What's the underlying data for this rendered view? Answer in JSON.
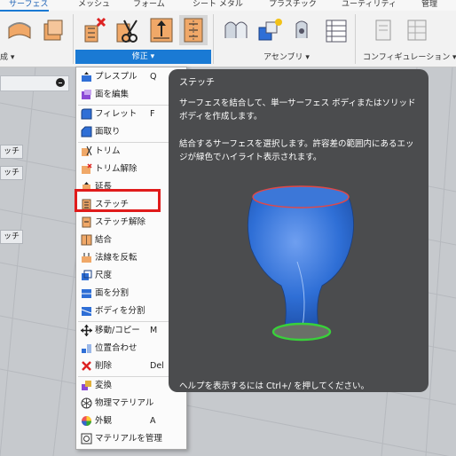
{
  "ribbon": {
    "tabs": [
      {
        "label": "サーフェス",
        "active": true
      },
      {
        "label": "メッシュ"
      },
      {
        "label": "フォーム"
      },
      {
        "label": "シート メタル"
      },
      {
        "label": "プラスチック"
      },
      {
        "label": "ユーティリティ"
      },
      {
        "label": "管理"
      }
    ],
    "groups": {
      "left_partial": "成 ▾",
      "modify": "修正 ▾",
      "assemble": "アセンブリ ▾",
      "configure": "コンフィギュレーション ▾"
    }
  },
  "viewport": {
    "chips": [
      "ッチ",
      "ッチ",
      "ッチ"
    ]
  },
  "menu": {
    "items": [
      {
        "label": "プレスプル",
        "shortcut": "Q",
        "icon": "press-pull-icon"
      },
      {
        "label": "面を編集",
        "shortcut": "",
        "icon": "edit-face-icon"
      },
      {
        "label": "フィレット",
        "shortcut": "F",
        "icon": "fillet-icon"
      },
      {
        "label": "面取り",
        "shortcut": "",
        "icon": "chamfer-icon"
      },
      {
        "label": "トリム",
        "shortcut": "",
        "icon": "trim-icon"
      },
      {
        "label": "トリム解除",
        "shortcut": "",
        "icon": "untrim-icon"
      },
      {
        "label": "延長",
        "shortcut": "",
        "icon": "extend-icon"
      },
      {
        "label": "ステッチ",
        "shortcut": "",
        "icon": "stitch-icon"
      },
      {
        "label": "ステッチ解除",
        "shortcut": "",
        "icon": "unstitch-icon"
      },
      {
        "label": "結合",
        "shortcut": "",
        "icon": "combine-icon"
      },
      {
        "label": "法線を反転",
        "shortcut": "",
        "icon": "reverse-normal-icon"
      },
      {
        "label": "尺度",
        "shortcut": "",
        "icon": "scale-icon"
      },
      {
        "label": "面を分割",
        "shortcut": "",
        "icon": "split-face-icon"
      },
      {
        "label": "ボディを分割",
        "shortcut": "",
        "icon": "split-body-icon"
      },
      {
        "label": "移動/コピー",
        "shortcut": "M",
        "icon": "move-copy-icon"
      },
      {
        "label": "位置合わせ",
        "shortcut": "",
        "icon": "align-icon"
      },
      {
        "label": "削除",
        "shortcut": "Del",
        "icon": "delete-icon"
      },
      {
        "label": "変換",
        "shortcut": "",
        "icon": "replace-icon"
      },
      {
        "label": "物理マテリアル",
        "shortcut": "",
        "icon": "physical-material-icon"
      },
      {
        "label": "外観",
        "shortcut": "A",
        "icon": "appearance-icon"
      },
      {
        "label": "マテリアルを管理",
        "shortcut": "",
        "icon": "manage-materials-icon"
      }
    ]
  },
  "tooltip": {
    "title": "ステッチ",
    "description": "サーフェスを結合して、単一サーフェス ボディまたはソリッド ボディを作成します。",
    "detail": "結合するサーフェスを選択します。許容差の範囲内にあるエッジが緑色でハイライト表示されます。",
    "help": "ヘルプを表示するには Ctrl+/ を押してください。"
  },
  "colors": {
    "accent": "#1a7ad4",
    "highlight": "#e01b1b",
    "tooltip_bg": "#4b4c4e",
    "model_blue": "#2f6fd6",
    "edge_green": "#39d13a",
    "edge_red": "#e04848"
  }
}
